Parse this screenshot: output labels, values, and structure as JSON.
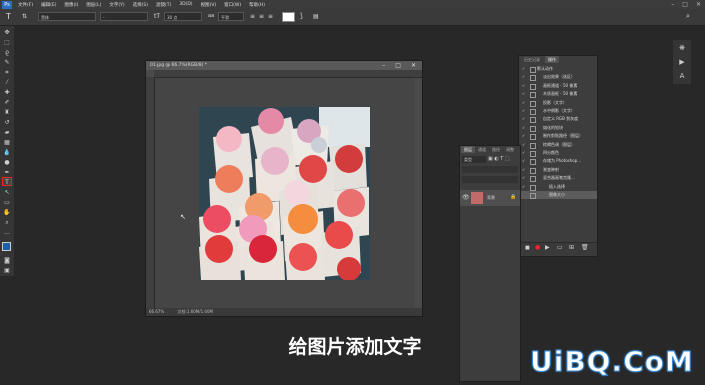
{
  "menubar": {
    "logo": "Ps",
    "items": [
      "文件(F)",
      "编辑(E)",
      "图像(I)",
      "图层(L)",
      "文字(Y)",
      "选择(S)",
      "滤镜(T)",
      "3D(D)",
      "视图(V)",
      "窗口(W)",
      "帮助(H)"
    ],
    "win_min": "–",
    "win_max": "□",
    "win_close": "✕"
  },
  "options": {
    "tool_icon": "T",
    "font_family": "黑体",
    "font_style": "-",
    "font_size": "30 点",
    "antialias": "平滑"
  },
  "document": {
    "title": "01.jpg @ 66.7%(RGB/8) *",
    "zoom": "66.67%",
    "doc_info": "文档:1.60M/1.60M"
  },
  "history": {
    "tabs": [
      "历史记录",
      "操作"
    ],
    "items": [
      {
        "label": "默认动作",
        "checked": "✓"
      },
      {
        "label": "淡出效果（选区）",
        "checked": "✓"
      },
      {
        "label": "画框通道 - 50 像素",
        "checked": "✓"
      },
      {
        "label": "木质画框 - 50 像素",
        "checked": "✓"
      },
      {
        "label": "投影（文字）",
        "checked": "✓"
      },
      {
        "label": "水中倒影（文字）",
        "checked": "✓"
      },
      {
        "label": "自定义 RGB 到灰度",
        "checked": "✓"
      },
      {
        "label": "熔化的铅块",
        "checked": "✓"
      },
      {
        "label": "制作剪贴路径（图层）",
        "checked": "✓"
      },
      {
        "label": "棕褐色调（图层）",
        "checked": "✓"
      },
      {
        "label": "四分颜色",
        "checked": "✓"
      },
      {
        "label": "存储为 Photoshop...",
        "checked": "✓"
      },
      {
        "label": "渐变映射",
        "checked": "✓"
      },
      {
        "label": "混合器画笔克隆...",
        "checked": "✓"
      },
      {
        "label": "插入选择",
        "checked": "✓"
      },
      {
        "label": "图像大小",
        "checked": ""
      }
    ]
  },
  "layers": {
    "tabs": [
      "图层",
      "通道",
      "路径",
      "调整"
    ],
    "kind": "类型",
    "layer_name": "背景"
  },
  "subtitle": "给图片添加文字",
  "watermark": "UiBQ.CoM"
}
